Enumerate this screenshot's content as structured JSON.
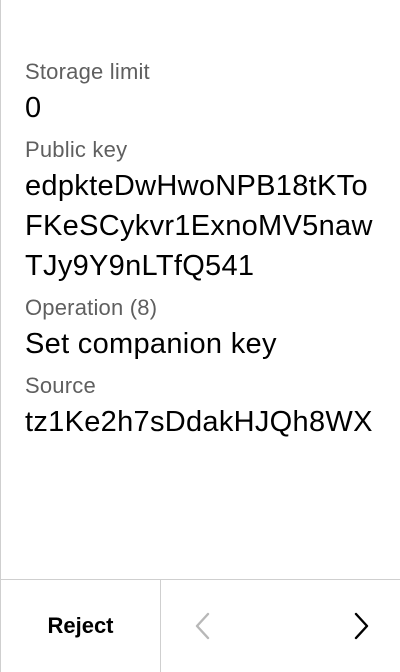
{
  "review": {
    "fields": [
      {
        "label": "Storage limit",
        "value": "0"
      },
      {
        "label": "Public key",
        "value": "edpkteDwHwoNPB18tKToFKeSCykvr1ExnoMV5nawTJy9Y9nLTfQ541"
      },
      {
        "label": "Operation (8)",
        "value": "Set companion key"
      },
      {
        "label": "Source",
        "value": "tz1Ke2h7sDdakHJQh8WX"
      }
    ]
  },
  "footer": {
    "reject_label": "Reject",
    "prev_icon": "chevron-left-icon",
    "next_icon": "chevron-right-icon",
    "prev_enabled": false,
    "next_enabled": true
  },
  "colors": {
    "label": "#5f5f5f",
    "value": "#000000",
    "divider": "#cfcfcf",
    "disabled": "#b8b8b8"
  }
}
